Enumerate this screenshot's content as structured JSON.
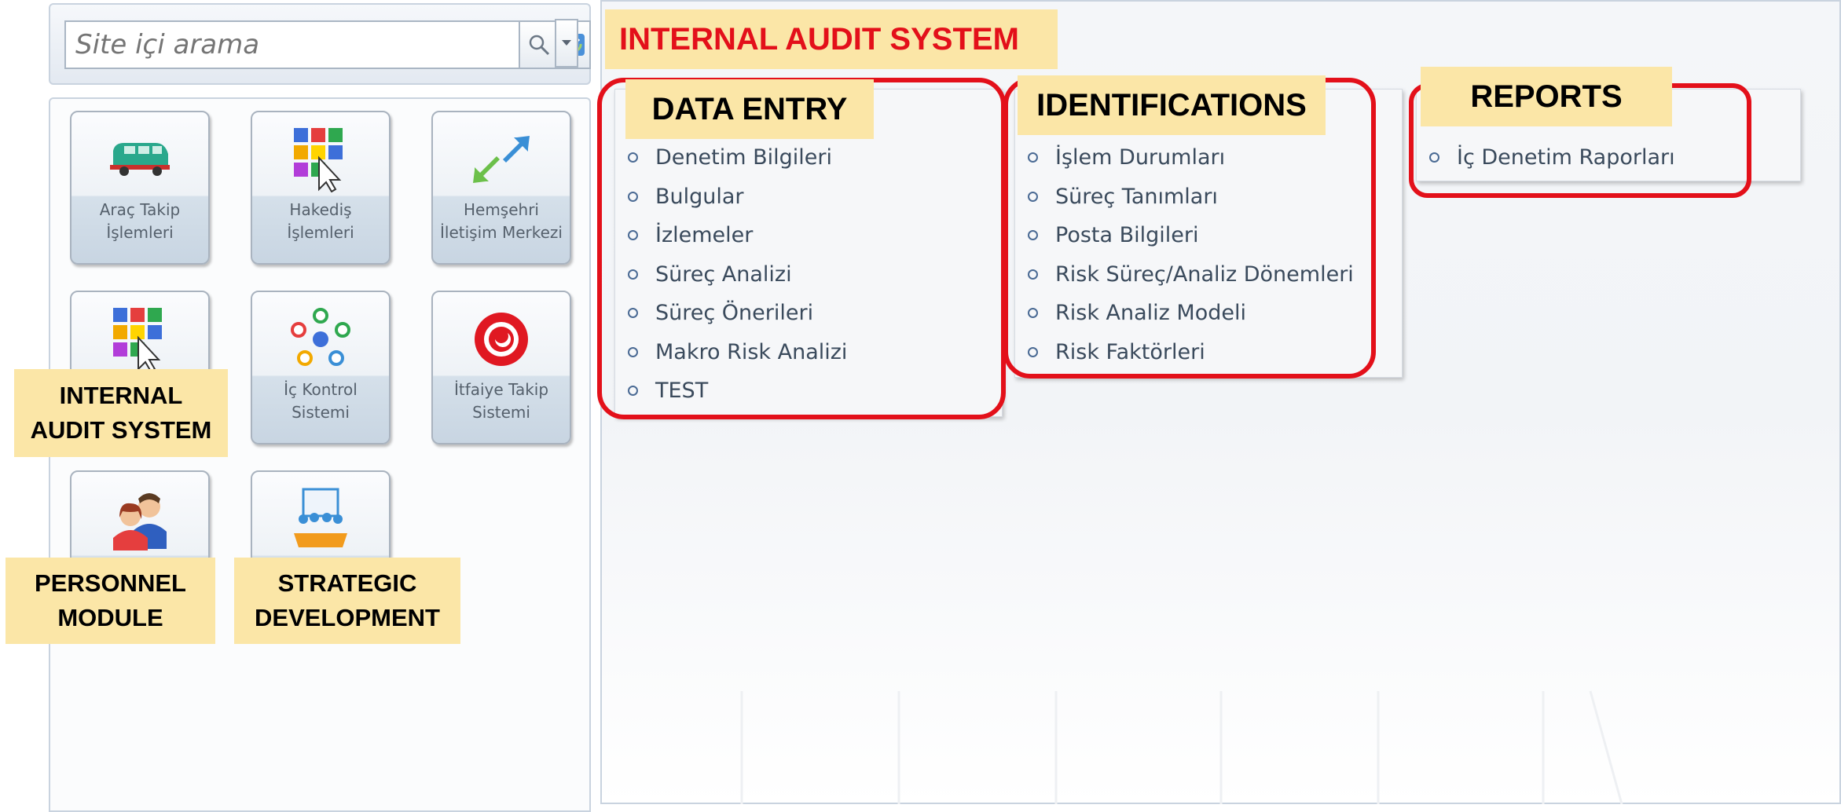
{
  "search": {
    "placeholder": "Site içi arama",
    "search_icon": "search-icon",
    "refresh_icon": "refresh-icon",
    "dropdown_icon": "chevron-down-icon"
  },
  "modules": [
    {
      "label": "Araç Takip İşlemleri",
      "icon": "van-icon"
    },
    {
      "label": "Hakediş İşlemleri",
      "icon": "grid-cursor-icon"
    },
    {
      "label": "Hemşehri İletişim Merkezi",
      "icon": "arrows-icon"
    },
    {
      "label": "",
      "icon": "grid-cursor-icon"
    },
    {
      "label": "İç Kontrol Sistemi",
      "icon": "network-icon"
    },
    {
      "label": "İtfaiye Takip Sistemi",
      "icon": "fire-emblem-icon"
    },
    {
      "label": "",
      "icon": "people-icon"
    },
    {
      "label": "",
      "icon": "meeting-icon"
    }
  ],
  "annotations": {
    "left_internal_audit": "INTERNAL AUDIT SYSTEM",
    "personnel": "PERSONNEL MODULE",
    "strategic": "STRATEGIC DEVELOPMENT",
    "title": "INTERNAL AUDIT SYSTEM",
    "data_entry": "DATA ENTRY",
    "identifications": "IDENTIFICATIONS",
    "reports": "REPORTS"
  },
  "data_entry_items": [
    "Denetim Bilgileri",
    "Bulgular",
    "İzlemeler",
    "Süreç Analizi",
    "Süreç Önerileri",
    "Makro Risk Analizi",
    "TEST"
  ],
  "identification_items": [
    "İşlem Durumları",
    "Süreç Tanımları",
    "Posta Bilgileri",
    "Risk Süreç/Analiz Dönemleri",
    "Risk Analiz Modeli",
    "Risk Faktörleri"
  ],
  "report_items": [
    "İç Denetim Raporları"
  ],
  "colors": {
    "highlight_red": "#e3101a",
    "note_yellow": "#fbe6a7",
    "title_red": "#e3101a"
  }
}
